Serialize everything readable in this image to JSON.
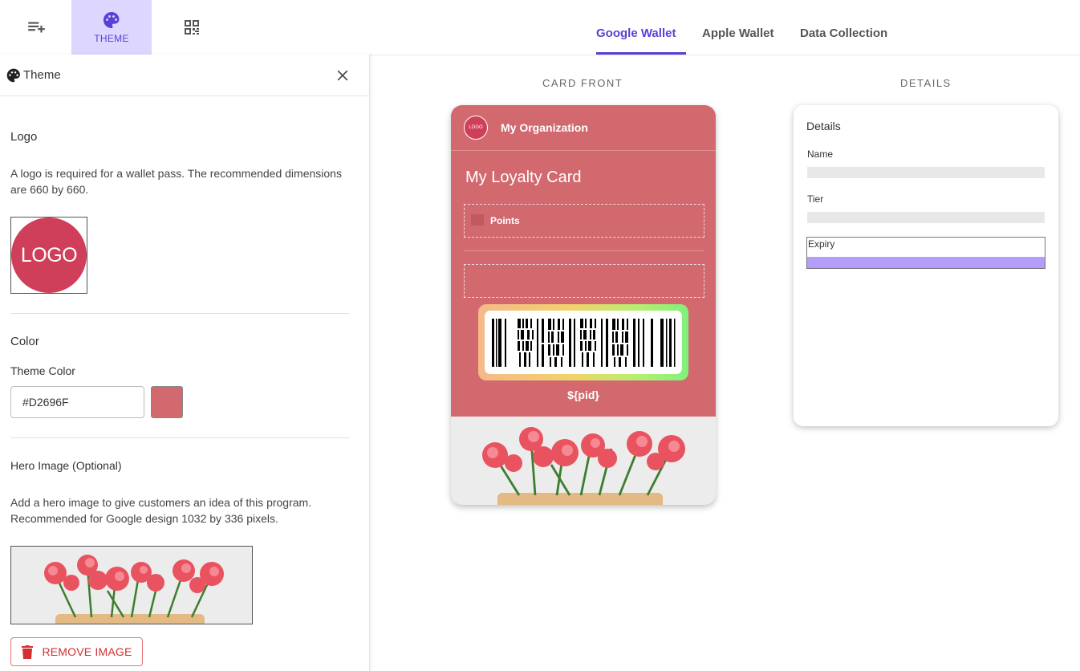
{
  "toolbar": {
    "theme_label": "THEME"
  },
  "tabs": [
    {
      "label": "Google Wallet",
      "active": true
    },
    {
      "label": "Apple Wallet",
      "active": false
    },
    {
      "label": "Data Collection",
      "active": false
    }
  ],
  "panel": {
    "title": "Theme",
    "logo": {
      "heading": "Logo",
      "description": "A logo is required for a wallet pass. The recommended dimensions are 660 by 660.",
      "logo_text": "LOGO"
    },
    "color": {
      "heading": "Color",
      "field_label": "Theme Color",
      "value": "#D2696F",
      "swatch": "#D2696F"
    },
    "hero": {
      "heading": "Hero Image (Optional)",
      "description": "Add a hero image to give customers an idea of this program. Recommended for Google design 1032 by 336 pixels.",
      "remove_label": "REMOVE IMAGE"
    }
  },
  "preview": {
    "front_heading": "CARD FRONT",
    "details_heading": "DETAILS",
    "card": {
      "logo_text": "LOGO",
      "org_name": "My Organization",
      "title": "My Loyalty Card",
      "points_label": "Points",
      "pid": "${pid}"
    },
    "details": {
      "title": "Details",
      "fields": [
        "Name",
        "Tier",
        "Expiry"
      ]
    }
  },
  "colors": {
    "accent": "#5B3FD6",
    "theme": "#D2696F",
    "remove": "#D32F2F"
  }
}
